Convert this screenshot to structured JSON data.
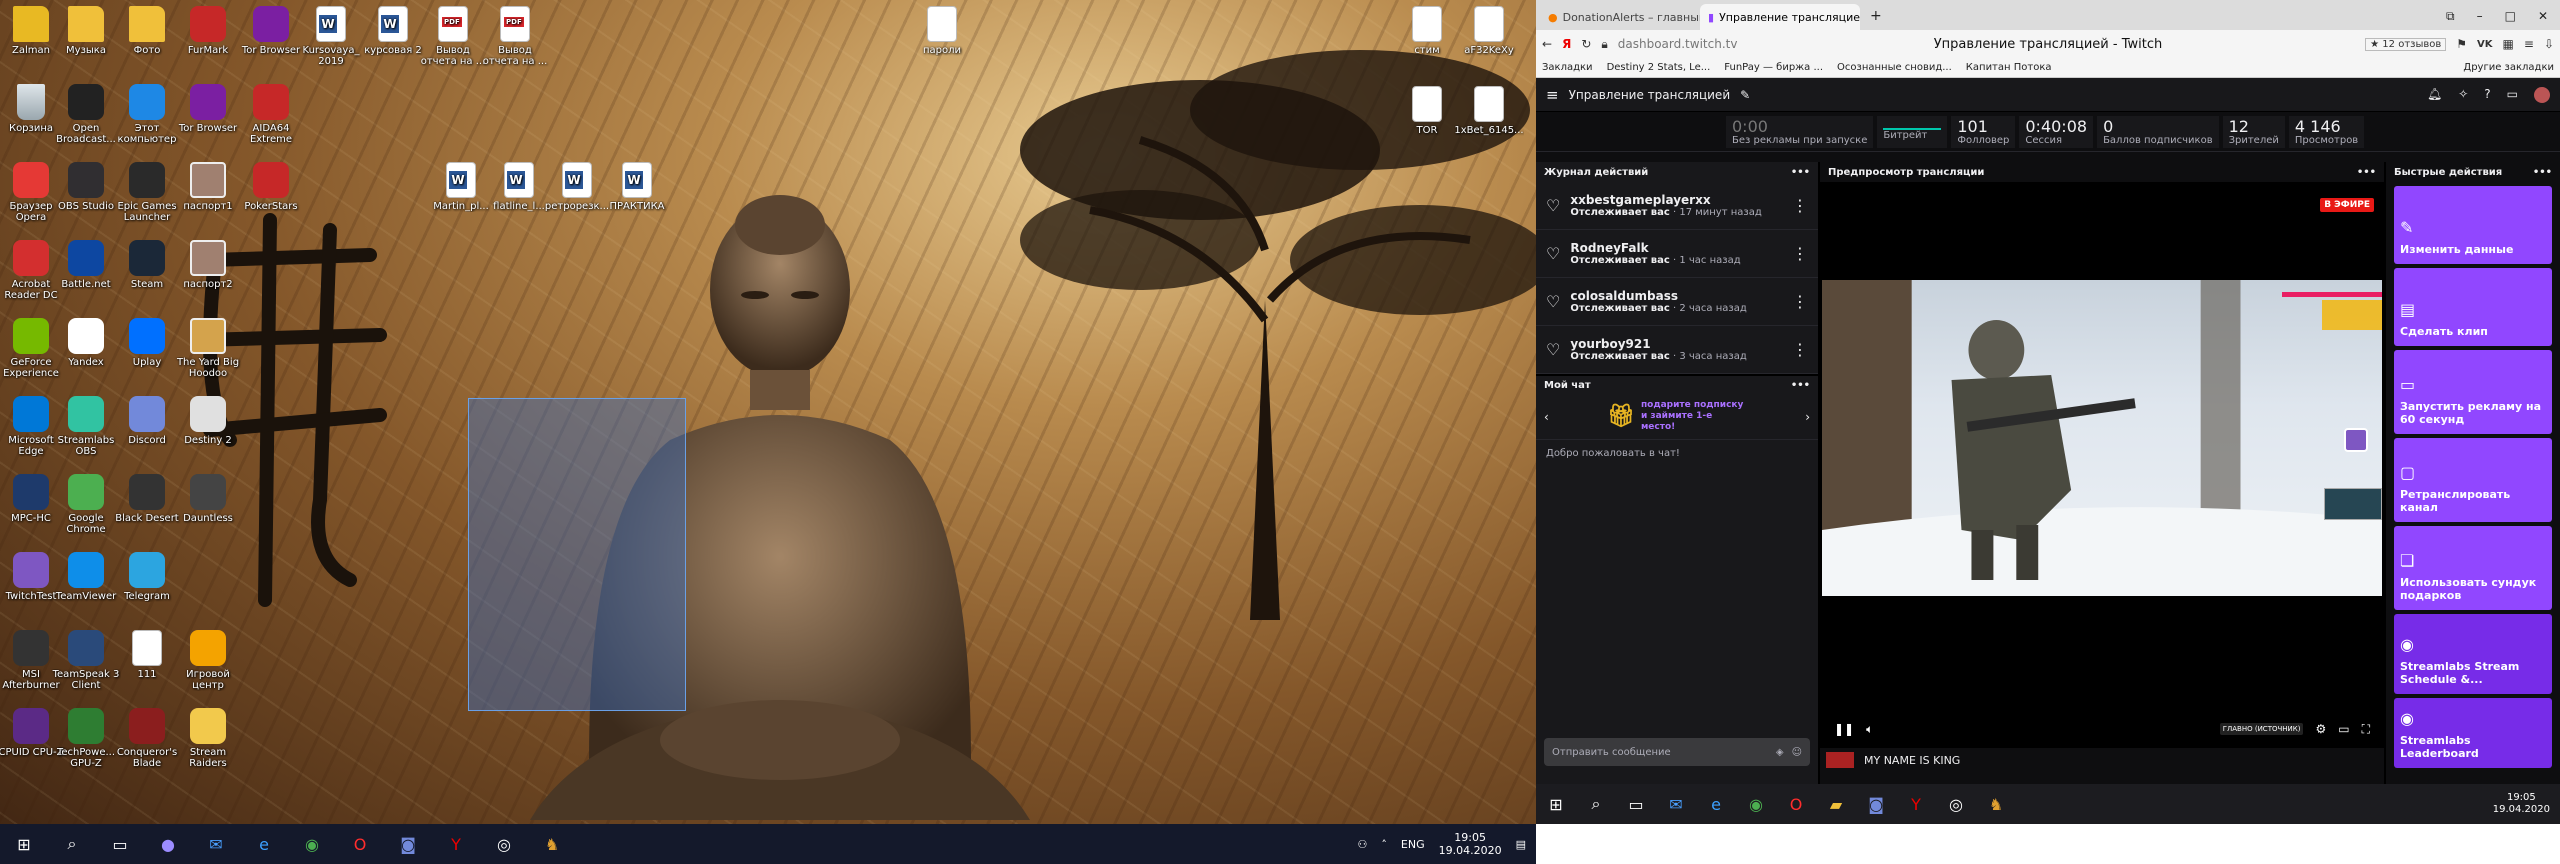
{
  "desktop": {
    "icons": [
      {
        "label": "Zalman",
        "type": "folder",
        "color": "#e8b923"
      },
      {
        "label": "Музыка",
        "type": "folder",
        "color": "#f0c03a"
      },
      {
        "label": "Фото",
        "type": "folder",
        "color": "#f0c03a"
      },
      {
        "label": "FurMark",
        "type": "app",
        "color": "#c62828"
      },
      {
        "label": "Tor Browser",
        "type": "app",
        "color": "#7b1fa2"
      },
      {
        "label": "Kursovaya_ 2019",
        "type": "doc-w",
        "color": "#2b5797"
      },
      {
        "label": "курсовая 2",
        "type": "doc-w",
        "color": "#2b5797"
      },
      {
        "label": "Вывод отчета на ...",
        "type": "doc-pdf",
        "color": "#d8262b"
      },
      {
        "label": "Вывод отчета на ...",
        "type": "doc-pdf",
        "color": "#d8262b"
      },
      {
        "label": "Корзина",
        "type": "bin",
        "color": "#b0bec5"
      },
      {
        "label": "Open Broadcast...",
        "type": "app",
        "color": "#222"
      },
      {
        "label": "Этот компьютер",
        "type": "app",
        "color": "#1e88e5"
      },
      {
        "label": "Tor Browser",
        "type": "app",
        "color": "#7b1fa2"
      },
      {
        "label": "AIDA64 Extreme",
        "type": "app",
        "color": "#c62828"
      },
      {
        "label": "Браузер Opera",
        "type": "app",
        "color": "#e53935"
      },
      {
        "label": "OBS Studio",
        "type": "app",
        "color": "#302e31"
      },
      {
        "label": "Epic Games Launcher",
        "type": "app",
        "color": "#2a2a2a"
      },
      {
        "label": "паспорт1",
        "type": "img",
        "color": "#a08070"
      },
      {
        "label": "PokerStars",
        "type": "app",
        "color": "#c62828"
      },
      {
        "label": "Acrobat Reader DC",
        "type": "app",
        "color": "#d32f2f"
      },
      {
        "label": "Battle.net",
        "type": "app",
        "color": "#0d47a1"
      },
      {
        "label": "Steam",
        "type": "app",
        "color": "#1b2838"
      },
      {
        "label": "паспорт2",
        "type": "img",
        "color": "#a08070"
      },
      {
        "label": "GeForce Experience",
        "type": "app",
        "color": "#76b900"
      },
      {
        "label": "Yandex",
        "type": "app",
        "color": "#fff"
      },
      {
        "label": "Uplay",
        "type": "app",
        "color": "#0070ff"
      },
      {
        "label": "The Yard Big Hoodoo",
        "type": "img",
        "color": "#d4a34c"
      },
      {
        "label": "Microsoft Edge",
        "type": "app",
        "color": "#0078d7"
      },
      {
        "label": "Streamlabs OBS",
        "type": "app",
        "color": "#31c3a2"
      },
      {
        "label": "Discord",
        "type": "app",
        "color": "#7289da"
      },
      {
        "label": "Destiny 2",
        "type": "app",
        "color": "#e0e0e0"
      },
      {
        "label": "MPC-HC",
        "type": "app",
        "color": "#1e3a6b"
      },
      {
        "label": "Google Chrome",
        "type": "app",
        "color": "#4caf50"
      },
      {
        "label": "Black Desert",
        "type": "app",
        "color": "#333"
      },
      {
        "label": "Dauntless",
        "type": "app",
        "color": "#444"
      },
      {
        "label": "TwitchTest",
        "type": "app",
        "color": "#7e57c2"
      },
      {
        "label": "TeamViewer",
        "type": "app",
        "color": "#0e8ee9"
      },
      {
        "label": "Telegram",
        "type": "app",
        "color": "#2ca5e0"
      },
      {
        "label": "MSI Afterburner",
        "type": "app",
        "color": "#333"
      },
      {
        "label": "TeamSpeak 3 Client",
        "type": "app",
        "color": "#2a4a7a"
      },
      {
        "label": "111",
        "type": "doc",
        "color": "#ddd"
      },
      {
        "label": "Игровой центр",
        "type": "app",
        "color": "#f4a300"
      },
      {
        "label": "CPUID CPU-Z",
        "type": "app",
        "color": "#5b2a86"
      },
      {
        "label": "TechPowe... GPU-Z",
        "type": "app",
        "color": "#2e7d32"
      },
      {
        "label": "Conqueror's Blade",
        "type": "app",
        "color": "#8b1e1e"
      },
      {
        "label": "Stream Raiders",
        "type": "app",
        "color": "#f2c94c"
      },
      {
        "label": "пароли",
        "type": "doc",
        "color": "#ddd"
      },
      {
        "label": "стим",
        "type": "doc",
        "color": "#ddd"
      },
      {
        "label": "aF32KeXy",
        "type": "doc",
        "color": "#ddd"
      },
      {
        "label": "TOR",
        "type": "doc",
        "color": "#ddd"
      },
      {
        "label": "1xBet_6145...",
        "type": "doc",
        "color": "#ddd"
      },
      {
        "label": "Martin_pl...",
        "type": "doc-w",
        "color": "#2b5797"
      },
      {
        "label": "flatline_l...",
        "type": "doc-w",
        "color": "#2b5797"
      },
      {
        "label": "ретрорезк...",
        "type": "doc-w",
        "color": "#2b5797"
      },
      {
        "label": "ПРАКТИКА",
        "type": "doc-w",
        "color": "#2b5797"
      }
    ],
    "taskbar": {
      "lang": "ENG",
      "time": "19:05",
      "date": "19.04.2020"
    }
  },
  "browser": {
    "tabs": [
      {
        "title": "DonationAlerts – главный"
      },
      {
        "title": "Управление трансляцией"
      }
    ],
    "url": "dashboard.twitch.tv",
    "page_title": "Управление трансляцией - Twitch",
    "reviews": "12 отзывов",
    "bookmarks": [
      "Закладки",
      "Destiny 2 Stats, Le...",
      "FunPay — биржа ...",
      "Осознанные сновид...",
      "Капитан Потока"
    ],
    "other_bookmarks": "Другие закладки"
  },
  "twitch": {
    "header_title": "Управление трансляцией",
    "stats": [
      {
        "value": "0:00",
        "label": "Без рекламы при запуске"
      },
      {
        "value": "",
        "label": "Битрейт"
      },
      {
        "value": "101",
        "label": "Фолловер"
      },
      {
        "value": "0:40:08",
        "label": "Сессия"
      },
      {
        "value": "0",
        "label": "Баллов подписчиков"
      },
      {
        "value": "12",
        "label": "Зрителей"
      },
      {
        "value": "4 146",
        "label": "Просмотров"
      }
    ],
    "activity": {
      "title": "Журнал действий",
      "items": [
        {
          "name": "xxbestgameplayerxx",
          "action": "Отслеживает вас",
          "time": "· 17 минут назад"
        },
        {
          "name": "RodneyFalk",
          "action": "Отслеживает вас",
          "time": "· 1 час назад"
        },
        {
          "name": "colosaldumbass",
          "action": "Отслеживает вас",
          "time": "· 2 часа назад"
        },
        {
          "name": "yourboy921",
          "action": "Отслеживает вас",
          "time": "· 3 часа назад"
        }
      ]
    },
    "chat": {
      "title": "Мой чат",
      "promo": "подарите подписку и займите 1-е место!",
      "welcome": "Добро пожаловать в чат!",
      "placeholder": "Отправить сообщение"
    },
    "preview": {
      "title": "Предпросмотр трансляции",
      "live": "В ЭФИРЕ",
      "source": "ГЛАВНО (ИСТОЧНИК)",
      "stream_title": "MY NAME IS KING"
    },
    "quick": {
      "title": "Быстрые действия",
      "actions": [
        {
          "label": "Изменить данные",
          "icon": "✎"
        },
        {
          "label": "Сделать клип",
          "icon": "▤"
        },
        {
          "label": "Запустить рекламу на 60 секунд",
          "icon": "▭"
        },
        {
          "label": "Ретранслировать канал",
          "icon": "▢"
        },
        {
          "label": "Использовать сундук подарков",
          "icon": "❏"
        },
        {
          "label": "Streamlabs Stream Schedule &...",
          "icon": "◉"
        },
        {
          "label": "Streamlabs Leaderboard",
          "icon": "◉"
        }
      ]
    }
  },
  "taskbar2": {
    "time": "19:05",
    "date": "19.04.2020"
  }
}
